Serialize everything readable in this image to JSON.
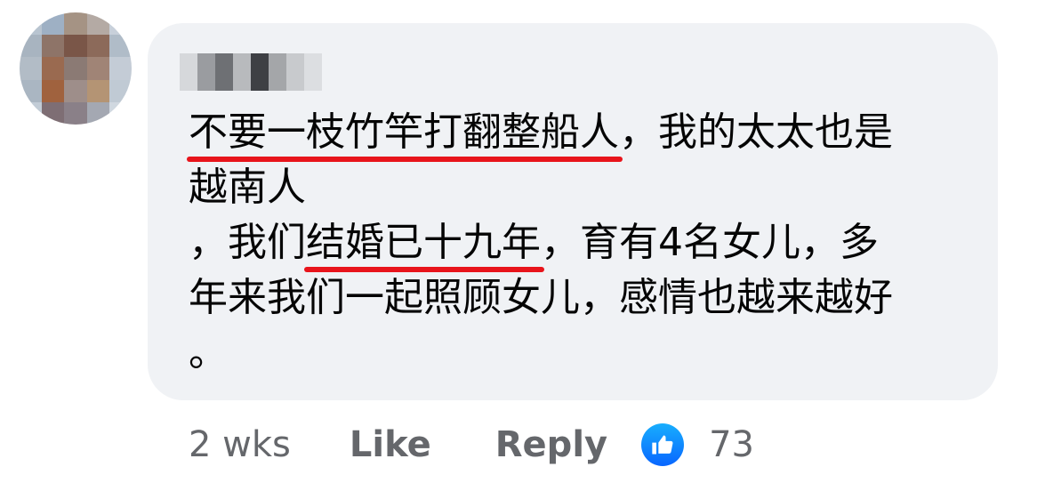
{
  "comment": {
    "lines": [
      {
        "hl": "不要一枝竹竿打翻整船人",
        "rest": "，我的太太也是"
      },
      {
        "text": "越南人"
      },
      {
        "pre": "，我们",
        "hl": "结婚已十九年",
        "rest": "，育有4名女儿，多"
      },
      {
        "text": "年来我们一起照顾女儿，感情也越来越好"
      },
      {
        "text": "。"
      }
    ],
    "highlight_color": "#e8141b"
  },
  "actions": {
    "time": "2 wks",
    "like_label": "Like",
    "reply_label": "Reply",
    "reaction_icon": "thumbs-up-icon",
    "reaction_count": "73"
  },
  "colors": {
    "bubble": "#f0f2f5",
    "text": "#050505",
    "meta": "#65676b",
    "like_blue": "#0866ff"
  }
}
